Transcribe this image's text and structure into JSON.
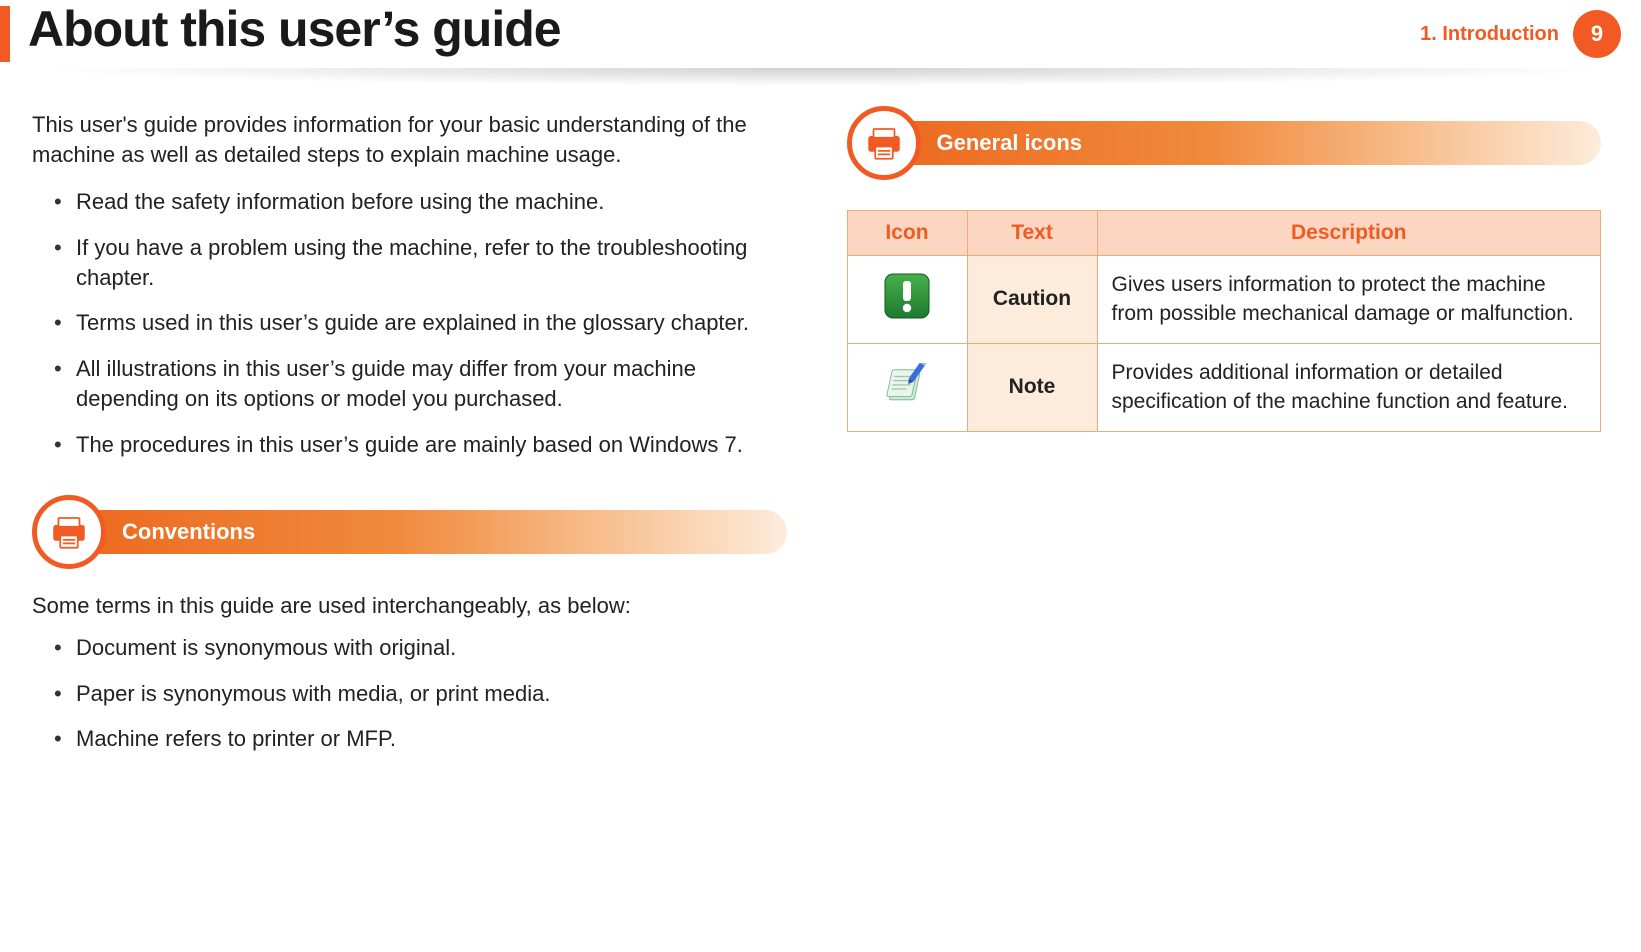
{
  "header": {
    "title": "About this user’s guide",
    "chapter": "1.  Introduction",
    "page": "9"
  },
  "left": {
    "intro": "This user's guide provides information for your basic understanding of the machine as well as detailed steps to explain machine usage.",
    "bullets": [
      "Read the safety information before using the machine.",
      "If you have a problem using the machine, refer to the troubleshooting chapter.",
      "Terms used in this user’s guide are explained in the glossary chapter.",
      "All illustrations in this user’s guide may differ from your machine depending on its options or model you purchased.",
      "The procedures in this user’s guide are mainly based on Windows 7."
    ],
    "conventions_title": "Conventions",
    "conventions_intro": "Some terms in this guide are used interchangeably, as below:",
    "conventions_bullets": [
      "Document is synonymous with original.",
      "Paper is synonymous with media, or print media.",
      "Machine refers to printer or MFP."
    ]
  },
  "right": {
    "general_icons_title": "General icons",
    "table": {
      "headers": {
        "icon": "Icon",
        "text": "Text",
        "desc": "Description"
      },
      "rows": [
        {
          "icon_name": "caution-icon",
          "text": "Caution",
          "desc": "Gives users information to protect the machine from possible mechanical damage or malfunction."
        },
        {
          "icon_name": "note-icon",
          "text": "Note",
          "desc": "Provides additional information or detailed specification of the machine function and feature."
        }
      ]
    }
  }
}
